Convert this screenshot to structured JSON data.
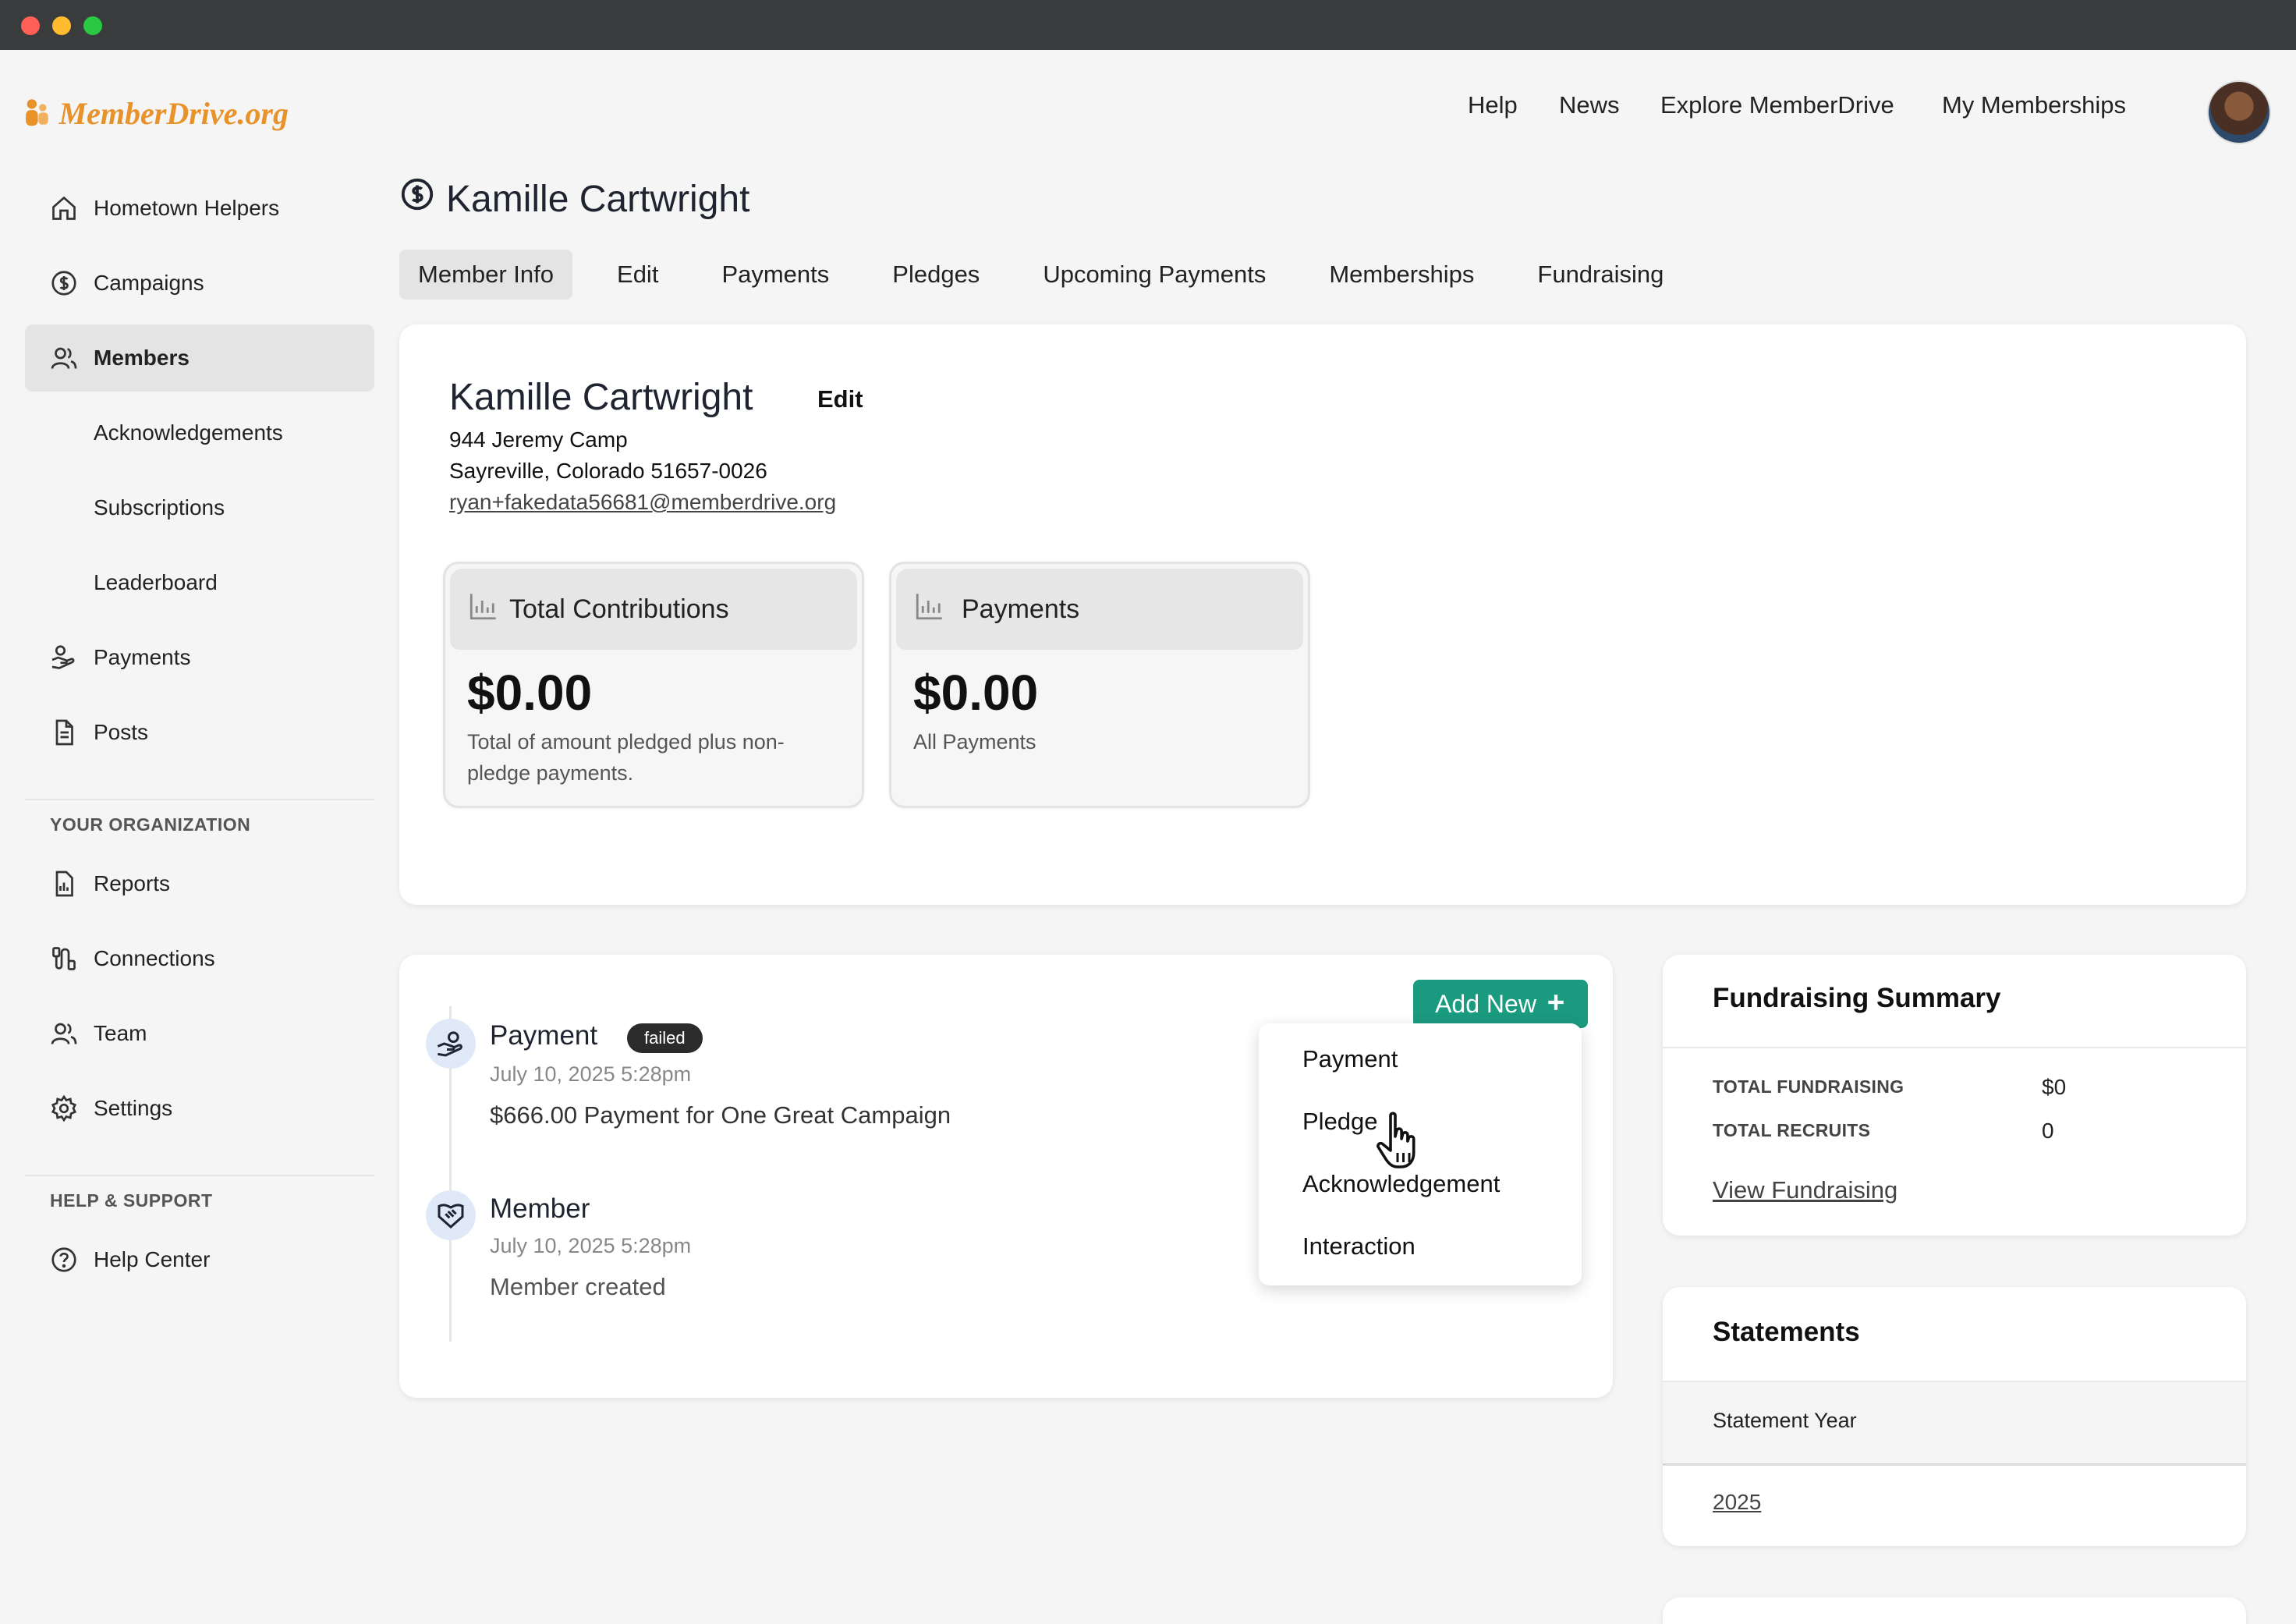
{
  "brand": {
    "name": "MemberDrive.org",
    "accent": "#e8922a",
    "teal": "#1a9a7f"
  },
  "topnav": {
    "items": [
      "Help",
      "News",
      "Explore MemberDrive",
      "My Memberships"
    ]
  },
  "sidebar": {
    "items": [
      {
        "label": "Hometown Helpers",
        "icon": "home-icon"
      },
      {
        "label": "Campaigns",
        "icon": "dollar-circle-icon"
      },
      {
        "label": "Members",
        "icon": "users-icon",
        "active": true
      },
      {
        "label": "Acknowledgements"
      },
      {
        "label": "Subscriptions"
      },
      {
        "label": "Leaderboard"
      },
      {
        "label": "Payments",
        "icon": "hand-coin-icon"
      },
      {
        "label": "Posts",
        "icon": "document-icon"
      }
    ],
    "org_heading": "YOUR ORGANIZATION",
    "org_items": [
      {
        "label": "Reports",
        "icon": "report-icon"
      },
      {
        "label": "Connections",
        "icon": "connections-icon"
      },
      {
        "label": "Team",
        "icon": "users-icon"
      },
      {
        "label": "Settings",
        "icon": "gear-icon"
      }
    ],
    "help_heading": "HELP & SUPPORT",
    "help_items": [
      {
        "label": "Help Center",
        "icon": "question-circle-icon"
      }
    ]
  },
  "page": {
    "title": "Kamille Cartwright",
    "tabs": [
      "Member Info",
      "Edit",
      "Payments",
      "Pledges",
      "Upcoming Payments",
      "Memberships",
      "Fundraising"
    ],
    "active_tab": "Member Info"
  },
  "member": {
    "name": "Kamille Cartwright",
    "edit_label": "Edit",
    "address1": "944 Jeremy Camp",
    "address2": "Sayreville, Colorado 51657-0026",
    "email": "ryan+fakedata56681@memberdrive.org"
  },
  "stats": [
    {
      "title": "Total Contributions",
      "value": "$0.00",
      "desc": "Total of amount pledged plus non-pledge payments."
    },
    {
      "title": "Payments",
      "value": "$0.00",
      "desc": "All Payments"
    }
  ],
  "activity": {
    "add_new_label": "Add New",
    "items": [
      {
        "type": "Payment",
        "badge": "failed",
        "date": "July 10, 2025 5:28pm",
        "text": "$666.00 Payment for One Great Campaign"
      },
      {
        "type": "Member",
        "date": "July 10, 2025 5:28pm",
        "text": "Member created"
      }
    ],
    "menu": [
      "Payment",
      "Pledge",
      "Acknowledgement",
      "Interaction"
    ]
  },
  "fundraising_summary": {
    "title": "Fundraising Summary",
    "rows": [
      {
        "label": "TOTAL FUNDRAISING",
        "value": "$0"
      },
      {
        "label": "TOTAL RECRUITS",
        "value": "0"
      }
    ],
    "link": "View Fundraising"
  },
  "statements": {
    "title": "Statements",
    "column": "Statement Year",
    "years": [
      "2025"
    ]
  }
}
